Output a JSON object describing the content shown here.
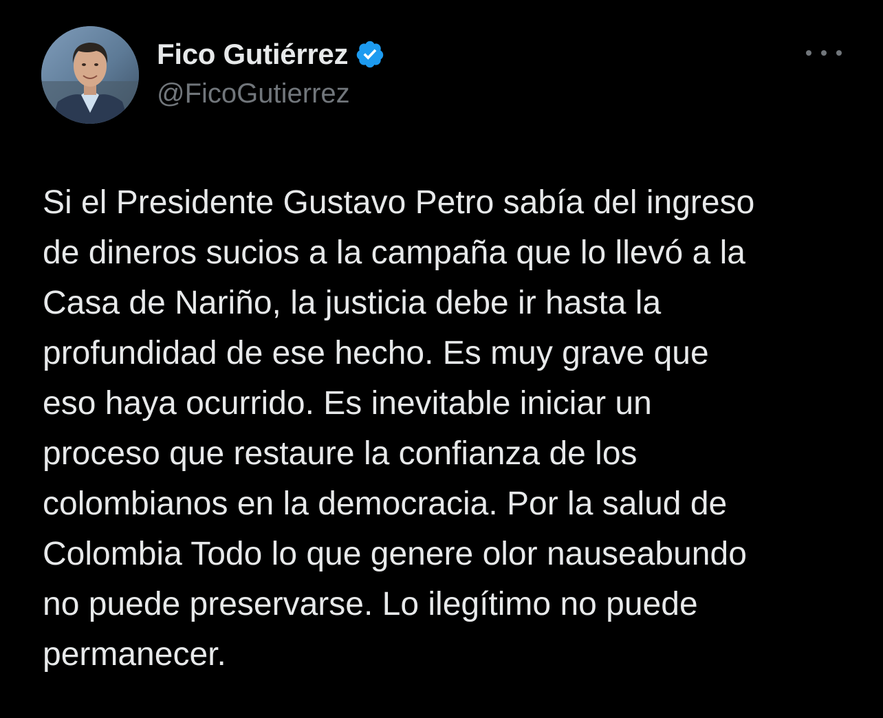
{
  "author": {
    "display_name": "Fico Gutiérrez",
    "handle": "@FicoGutierrez",
    "verified": true
  },
  "icons": {
    "verified": "verified-badge-icon",
    "more": "more-options-icon"
  },
  "colors": {
    "background": "#000000",
    "primary_text": "#e7e9ea",
    "secondary_text": "#71767b",
    "verified_blue": "#1d9bf0"
  },
  "tweet": {
    "lines": [
      "Si el Presidente Gustavo Petro sabía del ingreso",
      "de dineros sucios a la campaña que lo llevó a la",
      "Casa de Nariño, la justicia debe ir hasta la",
      "profundidad de ese hecho. Es muy grave que",
      "eso haya ocurrido. Es inevitable iniciar un",
      "proceso que restaure la confianza de los",
      "colombianos en la democracia. Por la salud de",
      "Colombia Todo lo que genere olor nauseabundo",
      "no puede preservarse. Lo ilegítimo no puede",
      "permanecer."
    ]
  }
}
